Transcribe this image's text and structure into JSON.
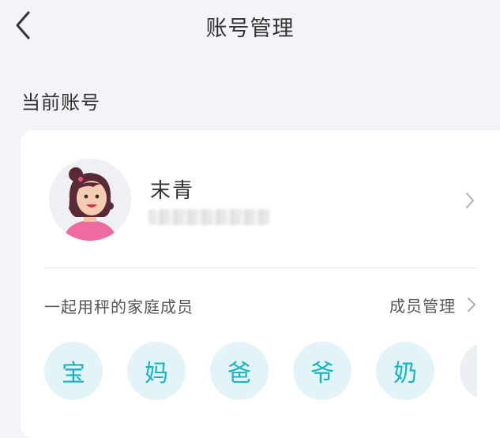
{
  "header": {
    "title": "账号管理",
    "back_icon": "chevron-left-icon"
  },
  "section": {
    "title": "当前账号"
  },
  "account": {
    "name": "末青",
    "phone_masked": "",
    "avatar_icon": "female-avatar-icon",
    "chevron_icon": "chevron-right-icon"
  },
  "family": {
    "label": "一起用秤的家庭成员",
    "manage_label": "成员管理",
    "chevron_icon": "chevron-right-icon",
    "members": [
      "宝",
      "妈",
      "爸",
      "爷",
      "奶"
    ]
  },
  "colors": {
    "background": "#f2f4f8",
    "card": "#ffffff",
    "member_bg": "#e3f4f8",
    "member_text": "#16b3c4"
  }
}
